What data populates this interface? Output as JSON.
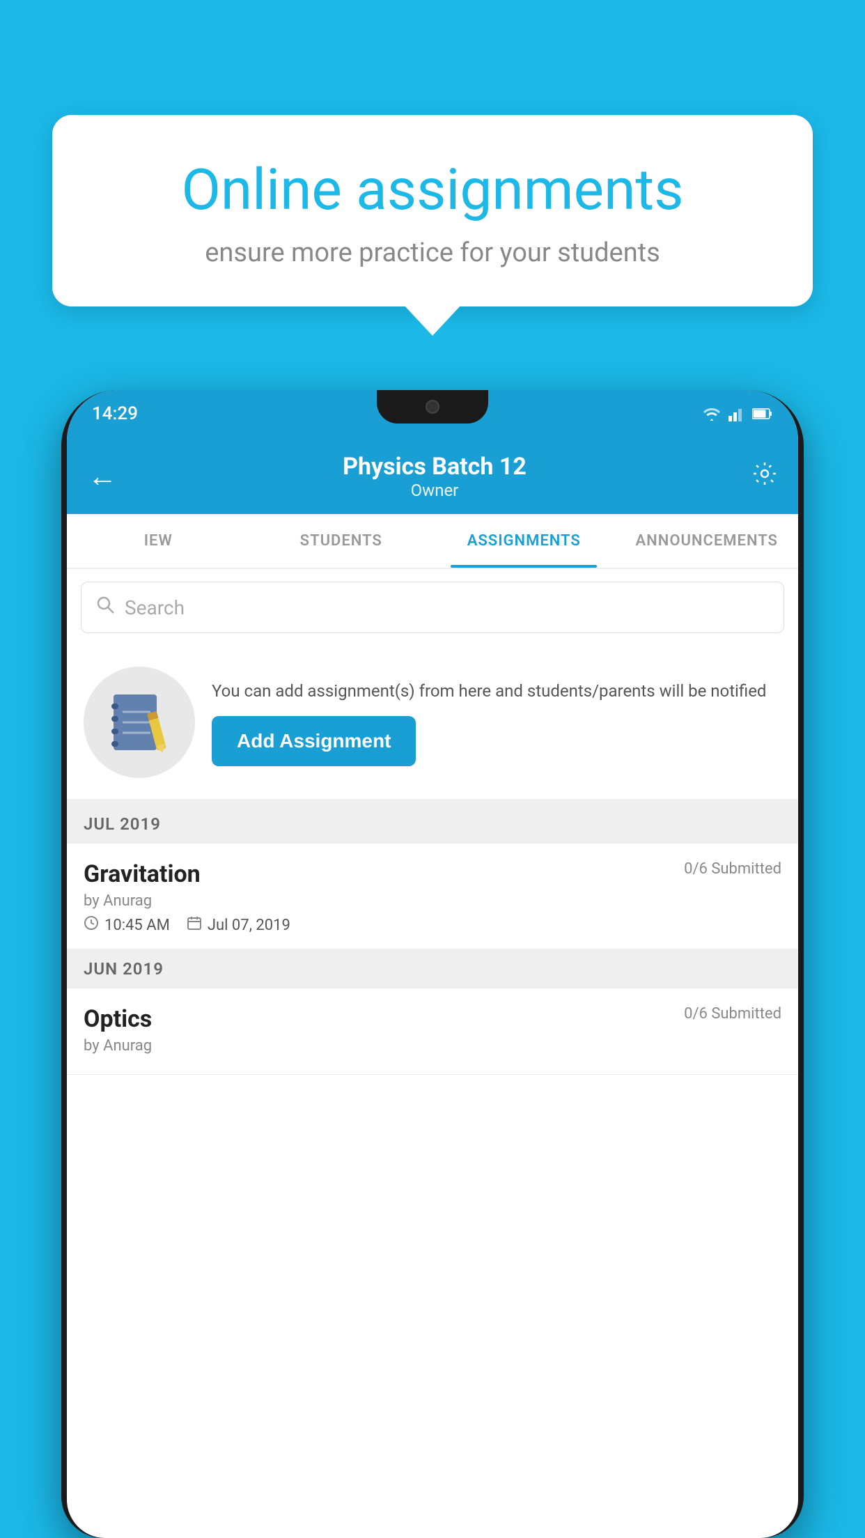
{
  "background_color": "#1bb8e8",
  "speech_bubble": {
    "title": "Online assignments",
    "subtitle": "ensure more practice for your students"
  },
  "status_bar": {
    "time": "14:29",
    "icons": [
      "wifi",
      "signal",
      "battery"
    ]
  },
  "header": {
    "title": "Physics Batch 12",
    "subtitle": "Owner",
    "back_label": "←",
    "settings_label": "⚙"
  },
  "tabs": [
    {
      "label": "IEW",
      "active": false
    },
    {
      "label": "STUDENTS",
      "active": false
    },
    {
      "label": "ASSIGNMENTS",
      "active": true
    },
    {
      "label": "ANNOUNCEMENTS",
      "active": false
    }
  ],
  "search": {
    "placeholder": "Search"
  },
  "promo": {
    "description": "You can add assignment(s) from here and students/parents will be notified",
    "button_label": "Add Assignment"
  },
  "sections": [
    {
      "month": "JUL 2019",
      "assignments": [
        {
          "name": "Gravitation",
          "submitted": "0/6 Submitted",
          "by": "by Anurag",
          "time": "10:45 AM",
          "date": "Jul 07, 2019"
        }
      ]
    },
    {
      "month": "JUN 2019",
      "assignments": [
        {
          "name": "Optics",
          "submitted": "0/6 Submitted",
          "by": "by Anurag",
          "time": "",
          "date": ""
        }
      ]
    }
  ]
}
